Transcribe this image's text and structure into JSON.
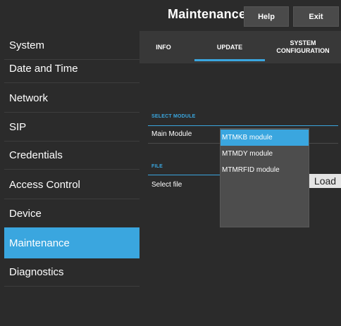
{
  "header": {
    "title": "Maintenance",
    "help_label": "Help",
    "exit_label": "Exit"
  },
  "sidebar": {
    "items": [
      {
        "label": "System",
        "active": false
      },
      {
        "label": "Date and Time",
        "active": false
      },
      {
        "label": "Network",
        "active": false
      },
      {
        "label": "SIP",
        "active": false
      },
      {
        "label": "Credentials",
        "active": false
      },
      {
        "label": "Access Control",
        "active": false
      },
      {
        "label": "Device",
        "active": false
      },
      {
        "label": "Maintenance",
        "active": true
      },
      {
        "label": "Diagnostics",
        "active": false
      }
    ]
  },
  "main": {
    "tabs": [
      {
        "label": "INFO",
        "active": false
      },
      {
        "label": "UPDATE",
        "active": true
      },
      {
        "label": "SYSTEM CONFIGURATION",
        "active": false
      }
    ],
    "select_module": {
      "section_label": "SELECT MODULE",
      "field_label": "Main Module"
    },
    "file": {
      "section_label": "FILE",
      "field_label": "Select file",
      "load_label": "Load"
    },
    "dropdown": {
      "options": [
        "MTMKB module",
        "MTMDY module",
        "MTMRFID module"
      ],
      "selected": "MTMKB module"
    }
  },
  "colors": {
    "accent": "#3aa6df",
    "background": "#2b2b2b",
    "tab_bar": "#383838",
    "dropdown_bg": "#4d4d4d"
  }
}
